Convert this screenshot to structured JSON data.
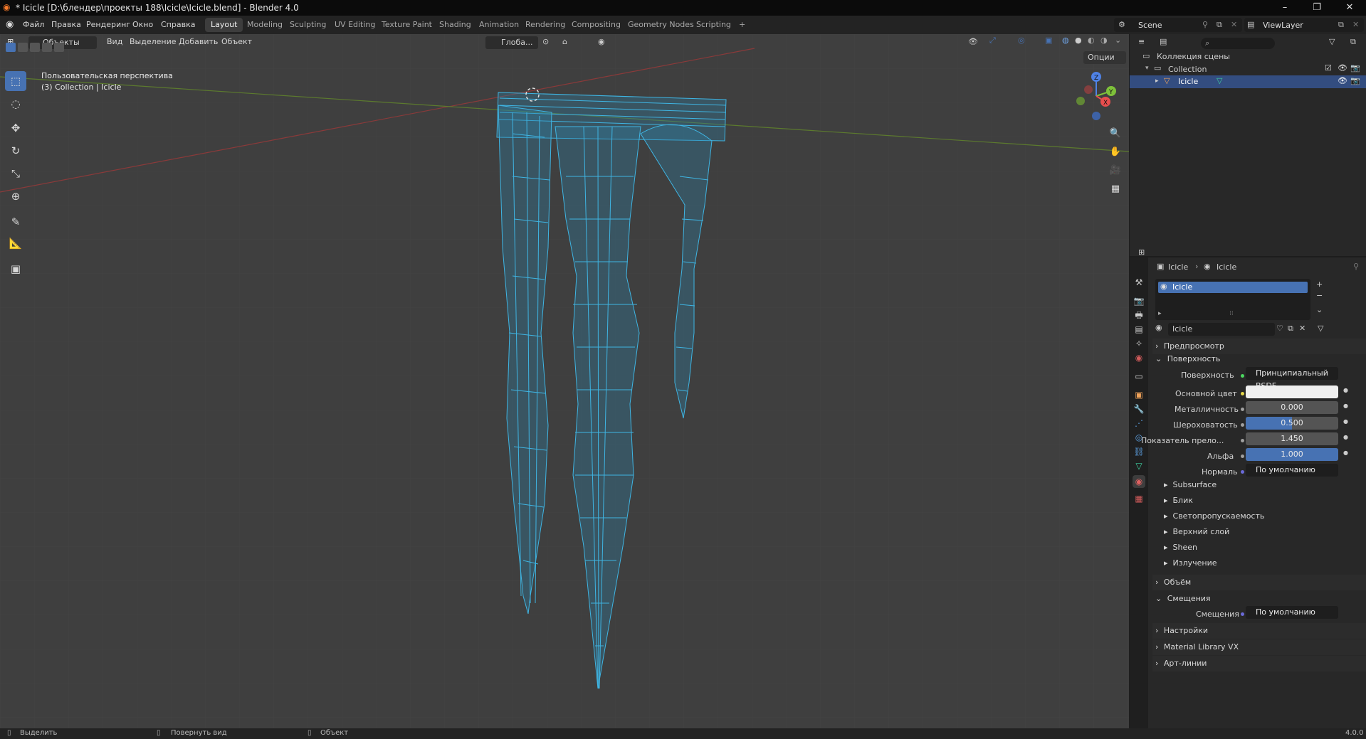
{
  "window": {
    "title": "* Icicle [D:\\блендер\\проекты 188\\Icicle\\Icicle.blend] - Blender 4.0",
    "minimize": "–",
    "restore": "❐",
    "close": "✕"
  },
  "menu": {
    "items": [
      "Файл",
      "Правка",
      "Рендеринг",
      "Окно",
      "Справка"
    ],
    "workspaces": [
      "Layout",
      "Modeling",
      "Sculpting",
      "UV Editing",
      "Texture Paint",
      "Shading",
      "Animation",
      "Rendering",
      "Compositing",
      "Geometry Nodes",
      "Scripting"
    ],
    "active_workspace": "Layout",
    "add_tab": "+",
    "scene": "Scene",
    "view_layer": "ViewLayer"
  },
  "viewport": {
    "mode": "Объекты",
    "menu": [
      "Вид",
      "Выделение",
      "Добавить",
      "Объект"
    ],
    "transform_orientation": "Глоба...",
    "options": "Опции",
    "overlay_title": "Пользовательская перспектива",
    "overlay_subtitle": "(3) Collection | Icicle",
    "gizmo": {
      "z": "Z",
      "y": "Y",
      "x": "X"
    },
    "wire_color": "#3fb5e3"
  },
  "outliner": {
    "root": "Коллекция сцены",
    "collection": "Collection",
    "object": "Icicle"
  },
  "properties": {
    "breadcrumb": [
      "Icicle",
      "Icicle"
    ],
    "slot": "Icicle",
    "material_name": "Icicle",
    "panels": {
      "preview": "Предпросмотр",
      "surface": "Поверхность",
      "volume": "Объём",
      "displacement": "Смещения",
      "settings": "Настройки",
      "material_library": "Material Library VX",
      "lineart": "Арт-линии"
    },
    "surface_rows": [
      {
        "label": "Поверхность",
        "value": "Принципиальный BSDF"
      },
      {
        "label": "Основной цвет",
        "value": ""
      },
      {
        "label": "Металличность",
        "value": "0.000"
      },
      {
        "label": "Шероховатость",
        "value": "0.500"
      },
      {
        "label": "Показатель прело...",
        "value": "1.450"
      },
      {
        "label": "Альфа",
        "value": "1.000"
      },
      {
        "label": "Нормаль",
        "value": "По умолчанию"
      }
    ],
    "sub_panels": [
      "Subsurface",
      "Блик",
      "Светопропускаемость",
      "Верхний слой",
      "Sheen",
      "Излучение"
    ],
    "displacement_row": {
      "label": "Смещения",
      "value": "По умолчанию"
    },
    "roughness_fraction": 0.5,
    "alpha_fraction": 1.0
  },
  "status": {
    "select": "Выделить",
    "rotate": "Повернуть вид",
    "object": "Объект",
    "version": "4.0.0"
  }
}
